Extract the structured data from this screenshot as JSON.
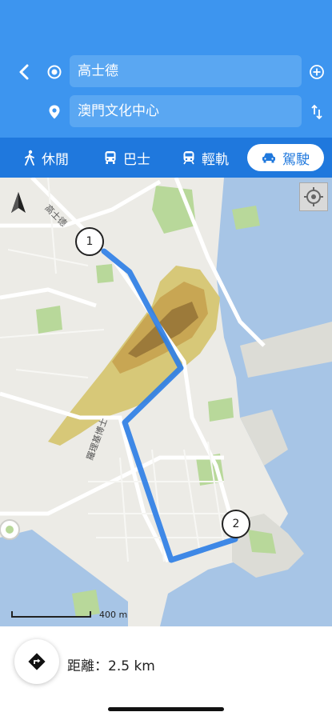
{
  "header": {
    "origin_value": "高士德",
    "destination_value": "澳門文化中心"
  },
  "modes": {
    "walk_label": "休閒",
    "bus_label": "巴士",
    "lrt_label": "輕軌",
    "drive_label": "駕駛",
    "selected": "drive"
  },
  "map": {
    "street_labels": {
      "top": "高士德",
      "middle": "羅理基博士"
    },
    "markers": {
      "start": "1",
      "end": "2"
    },
    "scale_label": "400 m",
    "colors": {
      "route": "#2f7fe6",
      "water": "#a7c5e6",
      "park": "#b8d89a",
      "hill": "#c8a653"
    }
  },
  "summary": {
    "distance_text": "距離：2.5 km"
  },
  "colors": {
    "header_bg": "#3d95ef",
    "modebar_bg": "#1f78dd"
  }
}
